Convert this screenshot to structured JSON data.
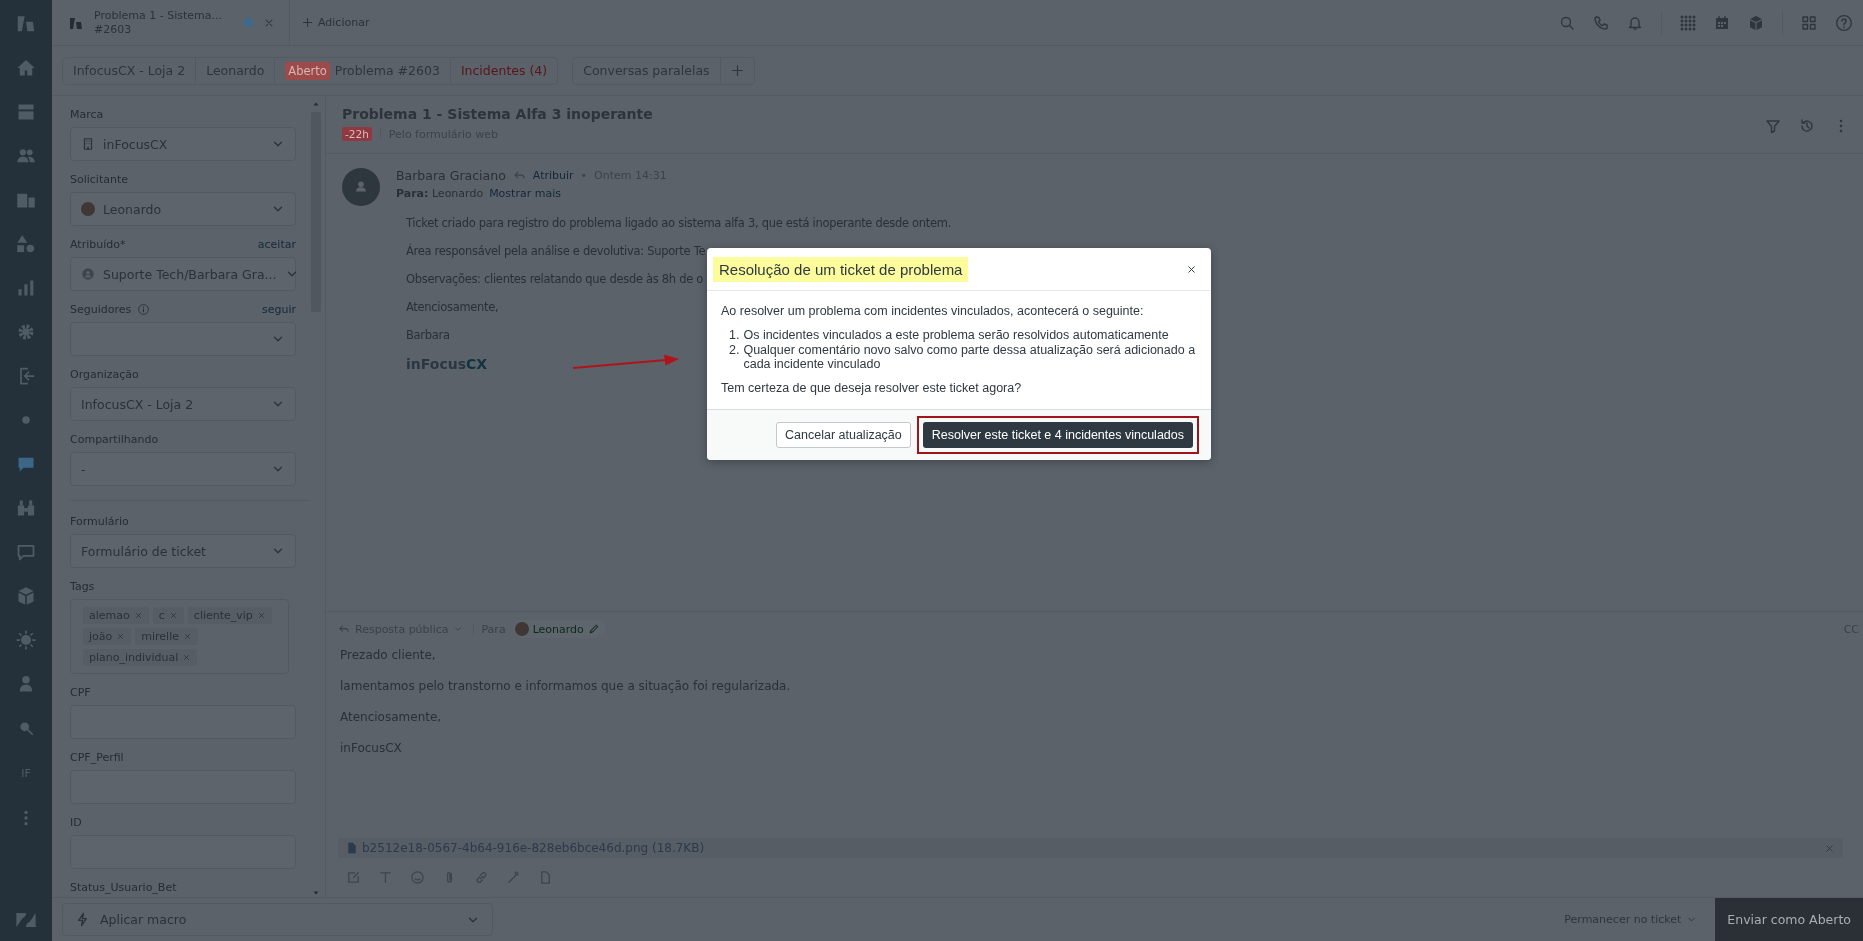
{
  "rail": {
    "items": [
      {
        "selected": false
      },
      {
        "selected": false
      },
      {
        "selected": false
      },
      {
        "selected": false
      },
      {
        "selected": false
      },
      {
        "selected": false
      },
      {
        "selected": false
      },
      {
        "selected": false
      },
      {
        "selected": false
      },
      {
        "selected": true
      },
      {
        "selected": false
      },
      {
        "selected": false
      },
      {
        "selected": false
      },
      {
        "selected": false
      },
      {
        "selected": false
      },
      {
        "selected": false
      }
    ],
    "label": "IF"
  },
  "top_tab": {
    "title": "Problema 1 - Sistema...",
    "subtitle": "#2603",
    "unsaved": true
  },
  "add_tab": "Adicionar",
  "breadcrumbs": [
    {
      "kind": "plain",
      "label": "InfocusCX - Loja 2"
    },
    {
      "kind": "plain",
      "label": "Leonardo"
    },
    {
      "kind": "ticket",
      "badge": "Aberto",
      "label": "Problema #2603"
    },
    {
      "kind": "alert",
      "label": "Incidentes (4)"
    }
  ],
  "side_conversations": "Conversas paralelas",
  "field_groups": [
    [
      {
        "kind": "brand",
        "label": "Marca",
        "value": "inFocusCX"
      },
      {
        "kind": "requester",
        "label": "Solicitante",
        "value": "Leonardo"
      },
      {
        "kind": "assignee",
        "label": "Atribuído*",
        "action": "aceitar",
        "value": "Suporte Tech/Barbara Gra..."
      },
      {
        "kind": "select",
        "label": "Seguidores",
        "info": true,
        "action": "seguir"
      },
      {
        "kind": "select",
        "label": "Organização",
        "value": "InfocusCX - Loja 2"
      },
      {
        "kind": "select",
        "label": "Compartilhando",
        "value": "-"
      }
    ],
    [
      {
        "kind": "select",
        "label": "Formulário",
        "value": "Formulário de ticket"
      },
      {
        "kind": "tags",
        "label": "Tags",
        "tags": [
          "alemao",
          "c",
          "cliente_vip",
          "joão",
          "mirelle",
          "plano_individual"
        ]
      },
      {
        "kind": "text",
        "label": "CPF"
      },
      {
        "kind": "text",
        "label": "CPF_Perfil"
      },
      {
        "kind": "text",
        "label": "ID"
      },
      {
        "kind": "heading",
        "label": "Status_Usuario_Bet"
      }
    ]
  ],
  "ticket": {
    "title": "Problema 1 - Sistema Alfa 3 inoperante",
    "sla": "-22h",
    "channel": "Pelo formulário web"
  },
  "message": {
    "author": "Barbara Graciano",
    "action": "Atribuir",
    "separator": "•",
    "time": "Ontem 14:31",
    "to_label": "Para:",
    "to": "Leonardo",
    "more": "Mostrar mais",
    "paragraphs": [
      "Ticket criado para registro do problema ligado ao sistema alfa 3, que está inoperante desde ontem.",
      "Área responsável pela análise e devolutiva: Suporte Te",
      "Observações: clientes relatando que desde às 8h de o",
      "Atenciosamente,",
      "Barbara"
    ],
    "logo_main": "inFocus",
    "logo_accent": "CX"
  },
  "compose": {
    "mode": "Resposta pública",
    "to_label": "Para",
    "recipient": "Leonardo",
    "cc": "CC",
    "lines": [
      "Prezado cliente,",
      "lamentamos pelo transtorno e informamos que a situação foi regularizada.",
      "Atenciosamente,",
      "inFocusCX"
    ],
    "attachment": "b2512e18-0567-4b64-916e-828eb6bce46d.png (18.7KB)"
  },
  "footer": {
    "macro": "Aplicar macro",
    "stay": "Permanecer no ticket",
    "submit": "Enviar como Aberto"
  },
  "modal": {
    "title": "Resolução de um ticket de problema",
    "intro": "Ao resolver um problema com incidentes vinculados, acontecerá o seguinte:",
    "items": [
      {
        "number": "1.",
        "text": "Os incidentes vinculados a este problema serão resolvidos automaticamente"
      },
      {
        "number": "2.",
        "text": "Qualquer comentário novo salvo como parte dessa atualização será adicionado a cada incidente vinculado"
      }
    ],
    "question": "Tem certeza de que deseja resolver este ticket agora?",
    "cancel": "Cancelar atualização",
    "confirm": "Resolver este ticket e 4 incidentes vinculados"
  }
}
